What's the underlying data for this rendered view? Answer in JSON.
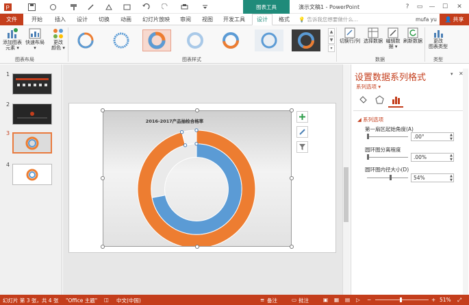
{
  "titlebar": {
    "context_group": "图表工具",
    "doc_title": "演示文稿1 - PowerPoint",
    "help": "?",
    "restore": "▭",
    "minimize": "—",
    "maximize": "☐",
    "close": "✕"
  },
  "tabs": {
    "file": "文件",
    "home": "开始",
    "insert": "插入",
    "design": "设计",
    "transitions": "切换",
    "animations": "动画",
    "slideshow": "幻灯片放映",
    "review": "审阅",
    "view": "视图",
    "developer": "开发工具",
    "chart_design": "设计",
    "format": "格式"
  },
  "tell_me": "告诉我您想要做什么...",
  "user": "mufa yu",
  "share": "共享",
  "ribbon": {
    "add_element_1": "添加图表",
    "add_element_2": "元素 ▾",
    "quick_layout_1": "快速布局",
    "quick_layout_2": "▾",
    "change_colors_1": "更改",
    "change_colors_2": "颜色 ▾",
    "group_layout": "图表布局",
    "group_styles": "图表样式",
    "switch_rowcol": "切换行/列",
    "select_data": "选择数据",
    "edit_data_1": "编辑数",
    "edit_data_2": "据 ▾",
    "refresh_data": "刷新数据",
    "group_data": "数据",
    "change_type_1": "更改",
    "change_type_2": "图表类型",
    "group_type": "类型"
  },
  "thumbnails": [
    "1",
    "2",
    "3",
    "4"
  ],
  "chart_data": {
    "type": "doughnut",
    "title": "2016-2017产品抽检合格率",
    "series": [
      {
        "values": [
          0.72,
          0.28
        ],
        "colors": [
          "#5b9bd5",
          "#eaeaea"
        ]
      },
      {
        "values": [
          0.96,
          0.04
        ],
        "colors": [
          "#ed7d31",
          "#f2f2f2"
        ]
      }
    ],
    "first_slice_angle": 0,
    "hole_size_percent": 54,
    "explosion_percent": 0
  },
  "format_pane": {
    "title": "设置数据系列格式",
    "subtitle": "系列选项 ▾",
    "section": "◢ 系列选项",
    "angle_label": "第一扇区起始角度(A)",
    "angle_value": ".00°",
    "explode_label": "圆环图分离程度",
    "explode_value": ".00%",
    "hole_label": "圆环图内径大小(D)",
    "hole_value": "54%",
    "pin": "▾",
    "close": "✕"
  },
  "status": {
    "slide_info": "幻灯片 第 3 张，共 4 张",
    "theme": "\"Office 主题\"",
    "language": "中文(中国)",
    "notes": "备注",
    "comments": "批注",
    "zoom": "51%"
  },
  "colors": {
    "accent": "#c43e1c",
    "context": "#1f8b7a",
    "ring_outer": "#ed7d31",
    "ring_inner": "#5b9bd5"
  }
}
